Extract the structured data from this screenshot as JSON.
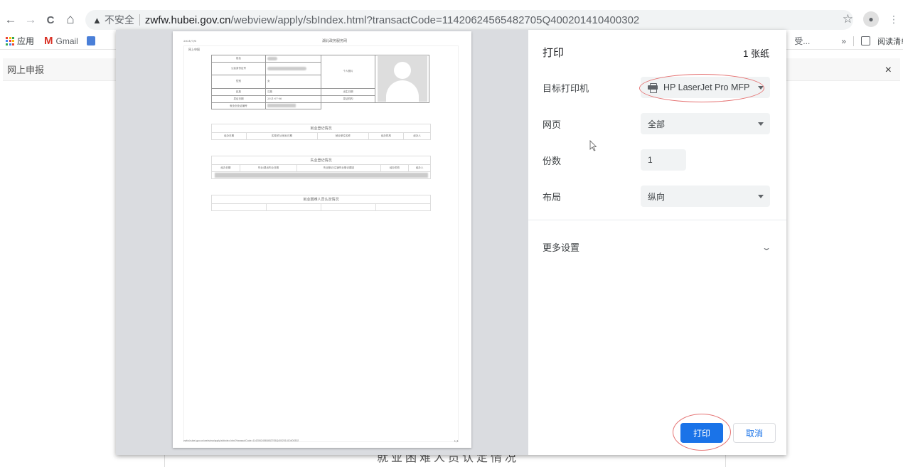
{
  "browser": {
    "nav": {
      "back": "←",
      "forward": "→",
      "reload": "C",
      "home": "⌂"
    },
    "omnibox": {
      "security_icon": "warning-triangle-icon",
      "security_label": "不安全",
      "url_host": "zwfw.hubei.gov.cn",
      "url_path": "/webview/apply/sbIndex.html?transactCode=11420624565482705Q400201410400302"
    },
    "bookmarks": {
      "apps_label": "应用",
      "gmail_label": "Gmail",
      "truncated_item": "受...",
      "overflow": "»",
      "reading_list_label": "阅读清单"
    }
  },
  "page": {
    "header_title": "网上申报",
    "close": "×",
    "bottom_text": "就业困难人员认定情况"
  },
  "print_dialog": {
    "title": "打印",
    "sheets": "1 张纸",
    "destination": {
      "label": "目标打印机",
      "value": "HP LaserJet Pro MFP"
    },
    "pages": {
      "label": "网页",
      "value": "全部"
    },
    "copies": {
      "label": "份数",
      "value": "1"
    },
    "layout": {
      "label": "布局",
      "value": "纵向"
    },
    "more_settings": "更多设置",
    "print_button": "打印",
    "cancel_button": "取消",
    "accent_color": "#1a73e8",
    "annotation_color": "#e57373"
  },
  "preview": {
    "date": "2021/7/6",
    "title": "湖北政务服务网",
    "section": "网上申报",
    "info_rows": [
      {
        "label": "姓名",
        "value": ""
      },
      {
        "label": "公民身份证号",
        "value": ""
      },
      {
        "label": "性别",
        "value": "女"
      },
      {
        "label": "民族",
        "value": "汉族",
        "label2": "出生日期",
        "value2": ""
      },
      {
        "label": "发证日期",
        "value": "2021-07-06",
        "label2": "发证机构",
        "value2": ""
      },
      {
        "label": "就业创业证编号",
        "value": ""
      }
    ],
    "photo_label": "个人照片",
    "employment": {
      "caption": "就业登记情况",
      "headers": [
        "经办日期",
        "实现/终止就业日期",
        "就业单位名称",
        "经办机构",
        "经办人"
      ]
    },
    "unemployment": {
      "caption": "失业登记情况",
      "headers": [
        "经办日期",
        "失业/退出失业日期",
        "失业登记/注销失业登记原因",
        "经办机构",
        "经办人"
      ]
    },
    "difficulty": {
      "caption": "就业困难人员认定情况"
    },
    "footer_url": "zwfw.hubei.gov.cn/webview/apply/sbIndex.html?transactCode=11420624565482705Q400201410400302",
    "page_number": "1/1"
  }
}
